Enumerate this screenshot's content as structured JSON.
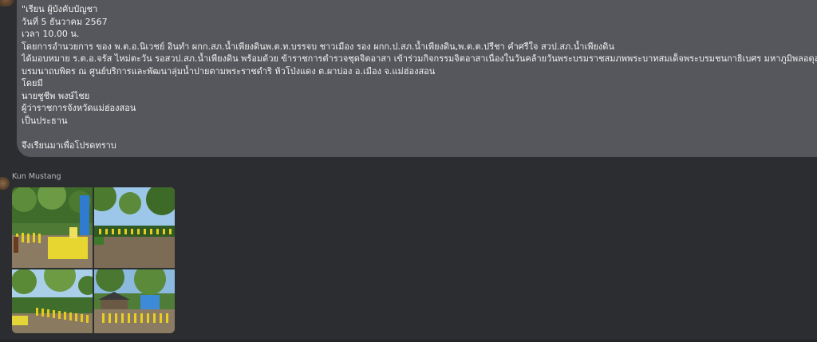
{
  "message": {
    "lines": [
      "\"เรียน ผู้บังคับบัญชา",
      "วันที่ 5 ธันวาคม 2567",
      "เวลา 10.00 น.",
      "โดยการอำนวยการ ของ พ.ต.อ.นิเวชย์ อินทำ ผกก.สภ.น้ำเพียงดินพ.ต.ท.บรรจบ ชาวเมือง รอง ผกก.ป.สภ.น้ำเพียงดิน,พ.ต.ต.ปรีชา คำศรีใจ สวป.สภ.น้ำเพียงดิน",
      "   ได้มอบหมาย ร.ต.อ.จรัส ไหม่ตะวัน รอสวป.สภ.น้ำเพียงดิน พร้อมด้วย ข้าราชการตำรวจชุดจิตอาสา เข้าร่วมกิจกรรมจิตอาสาเนื่องในวันคล้ายวันพระบรมราชสมภพพระบาทสมเด็จพระบรมชนกาธิเบศร มหาภูมิพลอดุลยเดชมหาราช",
      "บรมนาถบพิตร ณ ศูนย์บริการและพัฒนาลุ่มน้ำปายตามพระราชดำริ ห้วโป่งแดง ต.ผาบ่อง อ.เมือง จ.แม่ฮ่องสอน",
      "โดยมี",
      "นายชูชีพ พงษ์ไชย",
      "ผู้ว่าราชการจังหวัดแม่ฮ่องสอน",
      "เป็นประธาน",
      "",
      "จึงเรียนมาเพื่อโปรดทราบ"
    ]
  },
  "sender": {
    "name": "Kun Mustang"
  },
  "colors": {
    "background": "#2b2d31",
    "bubble": "#55575c",
    "text": "#f1f1f1",
    "sender_name": "#b5b8bd"
  }
}
